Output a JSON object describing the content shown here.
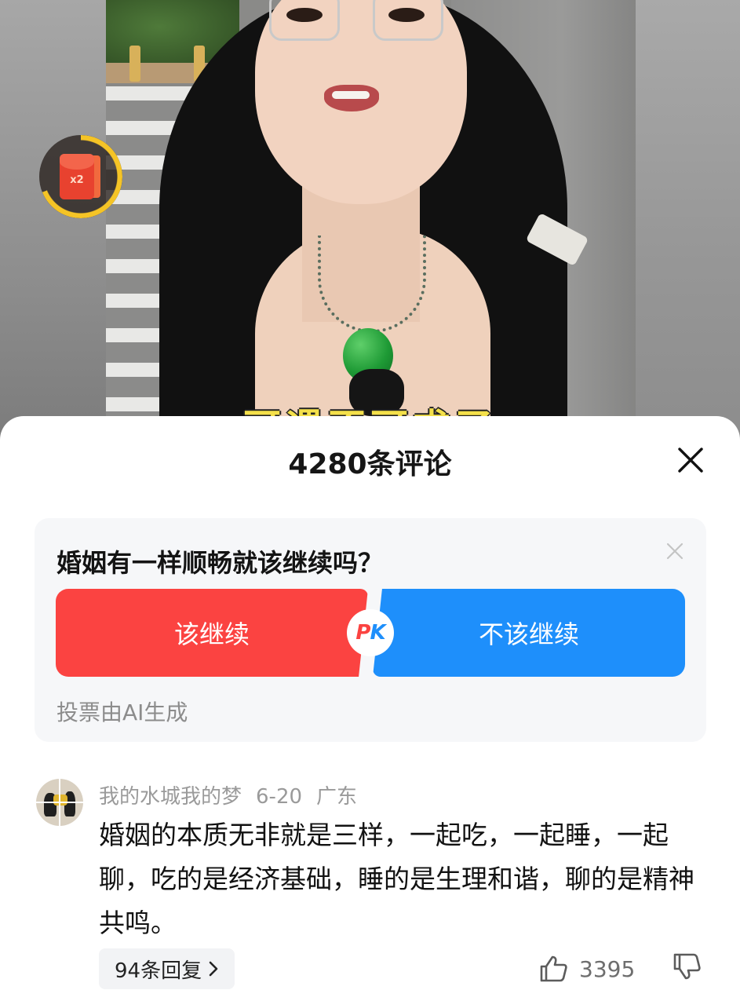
{
  "video": {
    "subtitle": "可遇不可求了",
    "reward": {
      "multiplier": "x2",
      "progress": 0.69,
      "ring_color": "#f5c426"
    }
  },
  "comments_sheet": {
    "title": "4280条评论",
    "close_icon": "close-icon"
  },
  "vote": {
    "question": "婚姻有一样顺畅就该继续吗？",
    "option_yes": "该继续",
    "option_no": "不该继续",
    "pk_p": "P",
    "pk_k": "K",
    "note": "投票由AI生成",
    "colors": {
      "yes": "#fb4341",
      "no": "#1e8ffb"
    }
  },
  "comment": {
    "username": "我的水城我的梦",
    "date": "6-20",
    "location": "广东",
    "text": "婚姻的本质无非就是三样，一起吃，一起睡，一起聊，吃的是经济基础，睡的是生理和谐，聊的是精神共鸣。",
    "replies_label": "94条回复",
    "likes": "3395"
  }
}
